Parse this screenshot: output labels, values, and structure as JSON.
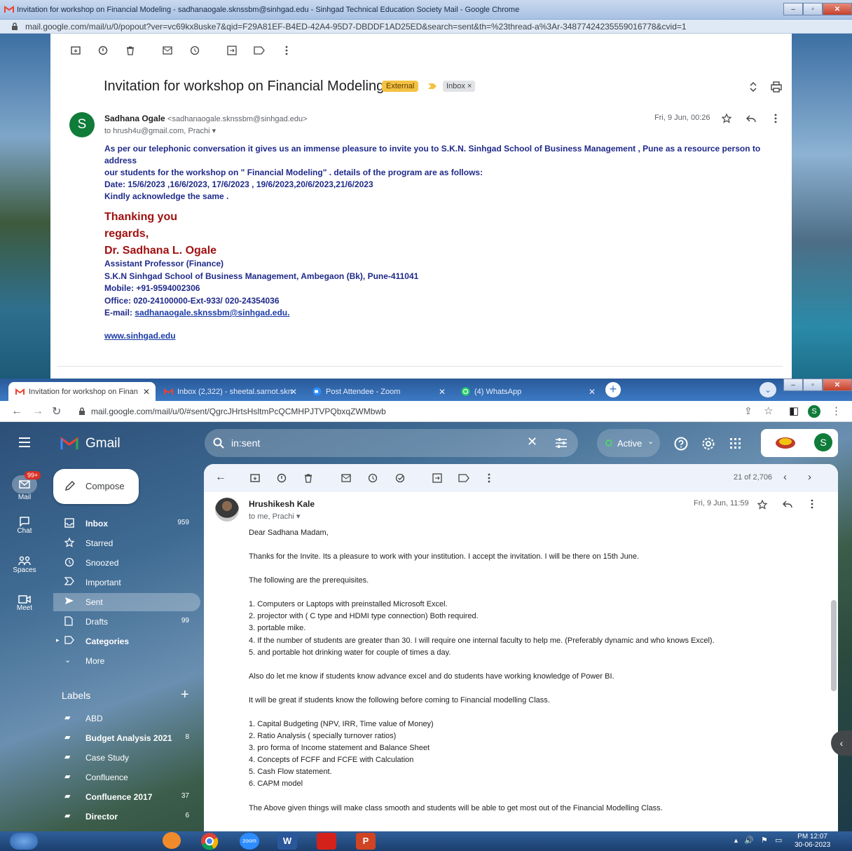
{
  "popout": {
    "window_title": "Invitation for workshop on Financial Modeling - sadhanaogale.sknssbm@sinhgad.edu - Sinhgad Technical Education Society Mail - Google Chrome",
    "url": "mail.google.com/mail/u/0/popout?ver=vc69kx8uske7&qid=F29A81EF-B4ED-42A4-95D7-DBDDF1AD25ED&search=sent&th=%23thread-a%3Ar-34877424235559016778&cvid=1",
    "subject": "Invitation for workshop on Financial Modeling",
    "external_badge": "External",
    "inbox_chip": "Inbox ×",
    "avatar_letter": "S",
    "sender_name": "Sadhana Ogale",
    "sender_email": "<sadhanaogale.sknssbm@sinhgad.edu>",
    "recipients": "to hrush4u@gmail.com, Prachi",
    "date": "Fri, 9 Jun, 00:26",
    "body": [
      "As per our telephonic  conversation it gives us an immense pleasure to invite you to S.K.N. Sinhgad School of Business Management , Pune  as a resource person to address",
      "our  students for the workshop on \" Financial Modeling\" . details of the program are as follows:",
      "Date: 15/6/2023 ,16/6/2023, 17/6/2023 , 19/6/2023,20/6/2023,21/6/2023",
      "Kindly acknowledge the same ."
    ],
    "closing": [
      "Thanking you",
      "regards,",
      "Dr. Sadhana L. Ogale"
    ],
    "signature": [
      "Assistant Professor (Finance)",
      "S.K.N Sinhgad School of Business Management, Ambegaon (Bk), Pune-411041",
      "Mobile: +91-9594002306",
      "Office: 020-24100000-Ext-933/ 020-24354036"
    ],
    "email_label": "E-mail: ",
    "email_link": "sadhanaogale.sknssbm@sinhgad.edu.",
    "website": "www.sinhgad.edu"
  },
  "chrome": {
    "tabs": [
      {
        "label": "Invitation for workshop on Finan"
      },
      {
        "label": "Inbox (2,322) - sheetal.sarnot.skn"
      },
      {
        "label": "Post Attendee - Zoom"
      },
      {
        "label": "(4) WhatsApp"
      }
    ],
    "url": "mail.google.com/mail/u/0/#sent/QgrcJHrtsHsltmPcQCMHPJTVPQbxqZWMbwb",
    "profile_letter": "S"
  },
  "gmail": {
    "brand": "Gmail",
    "search_query": "in:sent",
    "status": "Active",
    "avatar_letter": "S",
    "rail": {
      "mail": "Mail",
      "mail_badge": "99+",
      "chat": "Chat",
      "spaces": "Spaces",
      "meet": "Meet"
    },
    "compose": "Compose",
    "nav": [
      {
        "label": "Inbox",
        "count": "959"
      },
      {
        "label": "Starred",
        "count": ""
      },
      {
        "label": "Snoozed",
        "count": ""
      },
      {
        "label": "Important",
        "count": ""
      },
      {
        "label": "Sent",
        "count": ""
      },
      {
        "label": "Drafts",
        "count": "99"
      },
      {
        "label": "Categories",
        "count": ""
      },
      {
        "label": "More",
        "count": ""
      }
    ],
    "labels_heading": "Labels",
    "labels": [
      {
        "label": "ABD",
        "count": ""
      },
      {
        "label": "Budget Analysis 2021",
        "count": "8"
      },
      {
        "label": "Case Study",
        "count": ""
      },
      {
        "label": "Confluence",
        "count": ""
      },
      {
        "label": "Confluence 2017",
        "count": "37"
      },
      {
        "label": "Director",
        "count": "6"
      }
    ],
    "pager": "21 of 2,706",
    "message": {
      "sender": "Hrushikesh Kale",
      "recipients": "to me, Prachi",
      "date": "Fri, 9 Jun, 11:59",
      "lines": [
        "Dear Sadhana Madam,",
        "",
        "Thanks for the Invite. Its a pleasure to work with your institution. I accept the invitation. I will be there on 15th June.",
        "",
        "The following are the prerequisites.",
        "",
        "1. Computers or Laptops with preinstalled Microsoft Excel.",
        "2. projector with ( C type and HDMI type connection) Both required.",
        "3. portable mike.",
        "4. If the number of students are greater than 30. I will require one internal faculty to help me. (Preferably dynamic and who knows Excel).",
        "5. and portable hot drinking water for couple of times a day.",
        "",
        "Also do let me know if students know advance excel and do students have working knowledge of Power BI.",
        "",
        "It will be great if students know the following before coming to Financial modelling Class.",
        "",
        "1. Capital Budgeting (NPV, IRR, Time value of Money)",
        "2. Ratio Analysis ( specially turnover ratios)",
        "3. pro forma of Income statement and Balance Sheet",
        "4. Concepts of FCFF and FCFE with Calculation",
        "5. Cash Flow statement.",
        "6. CAPM model",
        "",
        "The Above given things will make class smooth and students will be able to get most out of the Financial Modelling Class."
      ]
    }
  },
  "taskbar": {
    "time": "PM 12:07",
    "date": "30-06-2023",
    "apps": [
      "chrome",
      "zoom",
      "word",
      "acrobat",
      "powerpoint"
    ]
  },
  "colors": {
    "external": "#f4c242",
    "gmail_red": "#ea4335",
    "link": "#1a3aa8",
    "signature_red": "#a01010"
  }
}
